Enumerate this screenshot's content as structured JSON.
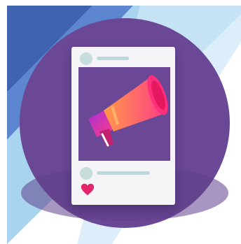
{
  "scene": {
    "description_free": true,
    "colors": {
      "background": "#ffffff",
      "circle": "#6a4896",
      "stripe_dark": "#3f63b0",
      "stripe_mid": "#5c86cf",
      "stripe_light": "#a9d4ef",
      "card": "#f4f4f6",
      "placeholder_line": "#b9d9db",
      "heart": "#e2256d",
      "megaphone_pink": "#ff3d86",
      "megaphone_orange": "#ff9a4a"
    },
    "icons": [
      "megaphone-icon",
      "heart-icon",
      "avatar-placeholder"
    ]
  }
}
